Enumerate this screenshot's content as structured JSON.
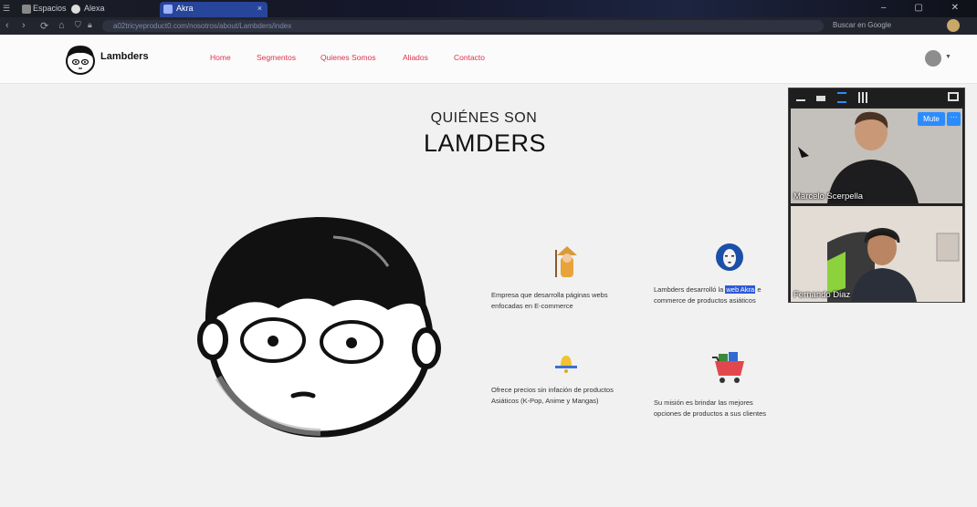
{
  "browser": {
    "tabs": [
      {
        "label": "Espacios"
      },
      {
        "label": "Alexa"
      },
      {
        "label": "Akra"
      }
    ],
    "window_controls": "‒ ▢ ✕",
    "nav_icons": {
      "back": "‹",
      "forward": "›",
      "reload": "⟳",
      "home": "⌂"
    },
    "url": "a02tricyeproduct0.com/nosotros/about/Lambders/index",
    "right_tools": "Buscar en Google"
  },
  "site": {
    "brand": "Lambders",
    "nav": [
      "Home",
      "Segmentos",
      "Quienes Somos",
      "Aliados",
      "Contacto"
    ],
    "accent_color": "#e0324f"
  },
  "main": {
    "heading_small": "QUIÉNES SON",
    "heading_big": "LAMDERS",
    "features": [
      {
        "icon": "monk-icon",
        "text_lines": [
          "Empresa que desarrolla páginas webs",
          "enfocadas en E-commerce"
        ]
      },
      {
        "icon": "noface-icon",
        "text_before": "Lambders desarrolló la ",
        "highlight": "web Akra",
        "text_after": " e",
        "line2": "commerce de productos asiáticos"
      },
      {
        "icon": "bell-icon",
        "text_lines": [
          "Ofrece precios sin infación de productos",
          "Asiáticos (K-Pop, Anime y Mangas)"
        ]
      },
      {
        "icon": "cart-icon",
        "text_lines": [
          "Su misión es brindar las mejores",
          "opciones de productos a sus clientes"
        ]
      }
    ]
  },
  "call": {
    "participants": [
      {
        "name": "Marcelo Scerpella"
      },
      {
        "name": "Fernando Diaz"
      }
    ],
    "mute_label": "Mute",
    "more_label": "···",
    "button_color": "#2b8cff"
  }
}
